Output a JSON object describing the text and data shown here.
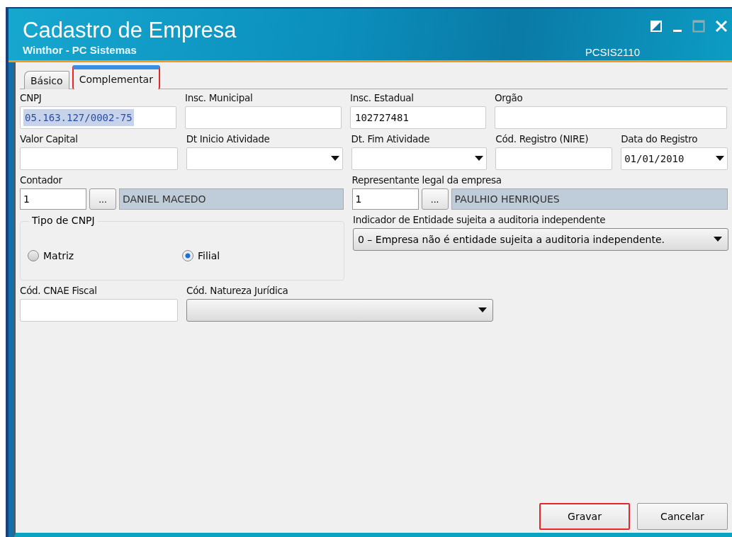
{
  "window": {
    "title": "Cadastro de Empresa",
    "subtitle": "Winthor - PC Sistemas",
    "code": "PCSIS2110"
  },
  "tabs": [
    {
      "label": "Básico",
      "selected": false,
      "highlighted": false
    },
    {
      "label": "Complementar",
      "selected": true,
      "highlighted": true
    }
  ],
  "row_1": [
    {
      "label": "CNPJ",
      "value": "05.163.127/0002-75",
      "value_selected": true
    },
    {
      "label": "Insc. Municipal"
    },
    {
      "label": "Insc. Estadual",
      "value": "102727481",
      "value_selected": false
    },
    {
      "label": "Orgão"
    }
  ],
  "row_2": [
    {
      "label": "Valor Capital",
      "kind": "text"
    },
    {
      "label": "Dt Inicio Atividade",
      "kind": "date"
    },
    {
      "label": "Dt. Fim Atividade",
      "kind": "date"
    },
    {
      "label": "Cód. Registro (NIRE)",
      "kind": "text"
    },
    {
      "label": "Data do Registro",
      "value": "01/01/2010",
      "kind": "date"
    }
  ],
  "lookups": [
    {
      "label": "Contador",
      "code": "1",
      "button": "...",
      "name": "DANIEL MACEDO"
    },
    {
      "label": "Representante legal da empresa",
      "code": "1",
      "button": "...",
      "name": "PAULHIO HENRIQUES"
    }
  ],
  "tipo_cnpj": {
    "title": "Tipo de CNPJ",
    "options": [
      {
        "label": "Matriz",
        "selected": false
      },
      {
        "label": "Filial",
        "selected": true
      }
    ]
  },
  "indicador": {
    "label": "Indicador de Entidade sujeita a auditoria independente",
    "value": "0 – Empresa não é entidade sujeita a auditoria independente."
  },
  "cnae": {
    "label": "Cód. CNAE Fiscal"
  },
  "natureza": {
    "label": "Cód. Natureza Jurídica"
  },
  "buttons": [
    {
      "label": "Gravar",
      "highlighted": true
    },
    {
      "label": "Cancelar",
      "highlighted": false
    }
  ]
}
